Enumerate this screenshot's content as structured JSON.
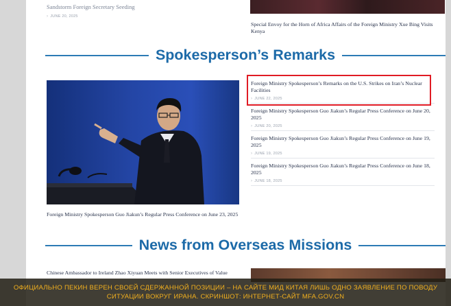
{
  "top": {
    "left_partial_text": "Sandstorm Foreign Secretary Seeding",
    "left_date": "JUNE 20, 2025",
    "right_title": "Special Envoy for the Horn of Africa Affairs of the Foreign Ministry Xue Bing Visits Kenya"
  },
  "spokesperson": {
    "heading": "Spokesperson’s Remarks",
    "featured_caption": "Foreign Ministry Spokesperson Guo Jiakun’s Regular Press Conference on June 23, 2025",
    "items": [
      {
        "title": "Foreign Ministry Spokesperson’s Remarks on the U.S. Strikes on Iran’s Nuclear Facilities",
        "date": "JUNE 22, 2025"
      },
      {
        "title": "Foreign Ministry Spokesperson Guo Jiakun’s Regular Press Conference on June 20, 2025",
        "date": "JUNE 20, 2025"
      },
      {
        "title": "Foreign Ministry Spokesperson Guo Jiakun’s Regular Press Conference on June 19, 2025",
        "date": "JUNE 19, 2025"
      },
      {
        "title": "Foreign Ministry Spokesperson Guo Jiakun’s Regular Press Conference on June 18, 2025",
        "date": "JUNE 18, 2025"
      }
    ]
  },
  "news": {
    "heading": "News from Overseas Missions",
    "first_title": "Chinese Ambassador to Ireland Zhao Xiyuan Meets with Senior Executives of Value"
  },
  "banner": {
    "text": "ОФИЦИАЛЬНО ПЕКИН ВЕРЕН СВОЕЙ СДЕРЖАННОЙ ПОЗИЦИИ – НА САЙТЕ МИД КИТАЯ ЛИШЬ ОДНО ЗАЯВЛЕНИЕ ПО ПОВОДУ СИТУАЦИИ ВОКРУГ ИРАНА. СКРИНШОТ: ИНТЕРНЕТ-САЙТ MFA.GOV.CN"
  },
  "colors": {
    "accent": "#1c6aa8",
    "highlight": "#e01b24",
    "banner_text": "#f2b01e"
  }
}
